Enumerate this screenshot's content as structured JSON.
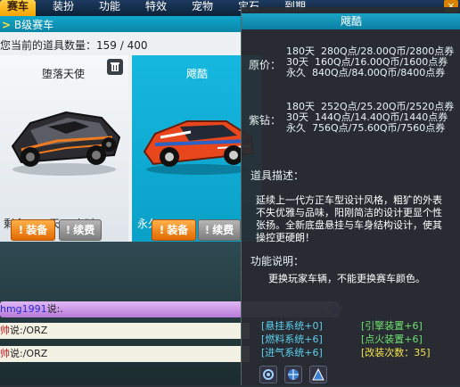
{
  "tabs": [
    {
      "label": "赛车",
      "active": true
    },
    {
      "label": "装扮",
      "active": false
    },
    {
      "label": "功能",
      "active": false
    },
    {
      "label": "特效",
      "active": false
    },
    {
      "label": "宠物",
      "active": false
    },
    {
      "label": "宝石",
      "active": false
    },
    {
      "label": "到期",
      "active": false
    }
  ],
  "close_label": "×",
  "sub_header": {
    "prefix": ">",
    "label": "B级赛车"
  },
  "inventory": {
    "count_label": "您当前的道具数量：159 / 400"
  },
  "cards": [
    {
      "name": "堕落天使",
      "remain": "剩余：14天23小时",
      "equip": "装备",
      "renew": "续费",
      "selected": false
    },
    {
      "name": "飕酷",
      "remain": "永久",
      "equip": "装备",
      "renew": "续费",
      "selected": true
    }
  ],
  "trash_icon": "trash-icon",
  "chat": [
    {
      "user": "hmg1991",
      "text": "说:."
    },
    {
      "user": "帅",
      "text": "说:/ORZ"
    },
    {
      "user": "帅",
      "text": "说:/ORZ"
    }
  ],
  "tooltip": {
    "title": "飕酷",
    "original_price_label": "原价：",
    "original_prices": [
      "180天  280Q点/28.00Q币/2800点券",
      "30天  160Q点/16.00Q币/1600点券",
      "永久  840Q点/84.00Q币/8400点券"
    ],
    "vip_price_label": "紫钻：",
    "vip_prices": [
      "180天  252Q点/25.20Q币/2520点券",
      "30天  144Q点/14.40Q币/1440点券",
      "永久  756Q点/75.60Q币/7560点券"
    ],
    "desc_label": "道具描述：",
    "desc_text": "延续上一代方正车型设计风格，粗犷的外表不失优雅与品味，阳刚简洁的设计更显个性张扬。全新底盘悬挂与车身结构设计，使其操控更硬朗！",
    "func_label": "功能说明：",
    "func_text": "更换玩家车辆，不能更换赛车颜色。",
    "stats": [
      {
        "text": "[悬挂系统+0]",
        "color": "blue"
      },
      {
        "text": "[引擎装置+6]",
        "color": "green"
      },
      {
        "text": "[燃料系统+6]",
        "color": "blue"
      },
      {
        "text": "[点火装置+6]",
        "color": "green"
      },
      {
        "text": "[进气系统+6]",
        "color": "blue"
      },
      {
        "text": "[改装次数：35]",
        "color": "yellow"
      }
    ],
    "bottom_icons": [
      "gear-icon",
      "globe-icon",
      "triangle-icon"
    ]
  }
}
